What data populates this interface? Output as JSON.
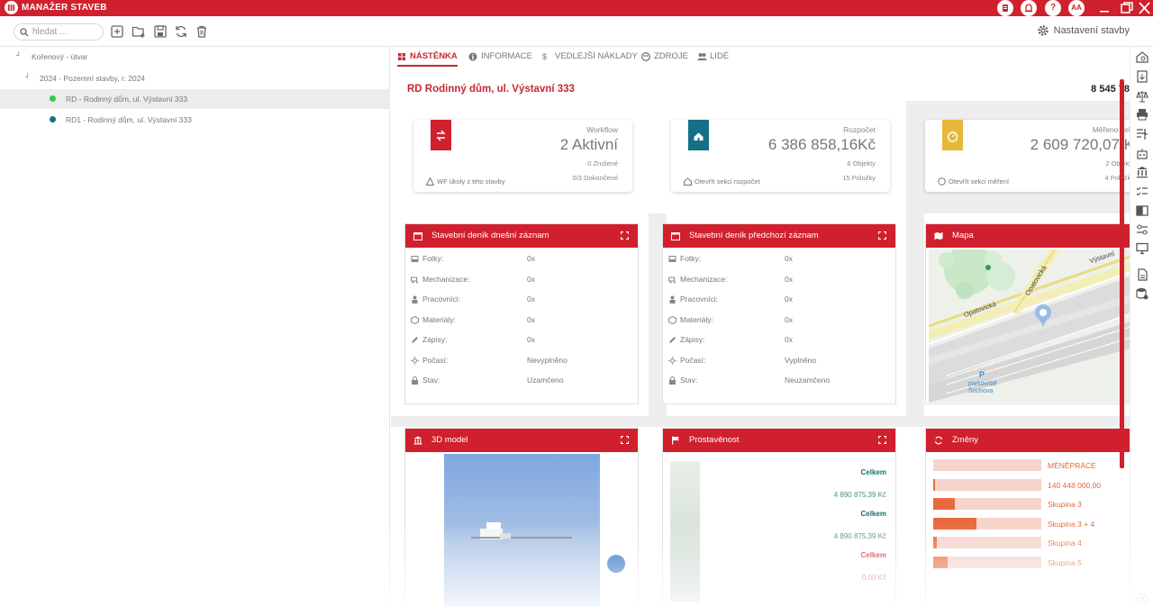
{
  "app": {
    "title": "MANAŽER STAVEB"
  },
  "titlebar": {
    "user_initials": "AA",
    "help_label": "?"
  },
  "toolbar": {
    "search_placeholder": "hledat ...",
    "settings_label": "Nastavení stavby"
  },
  "tree": {
    "items": [
      {
        "label": "Kořenový - útvar"
      },
      {
        "label": "2024 - Pozemní stavby, r. 2024"
      },
      {
        "label": "RD - Rodinný dům, ul. Výstavní 333",
        "status_color": "#2ecc4a"
      },
      {
        "label": "RD1 - Rodinný dům, ul. Výstavní 333",
        "status_color": "#156f86"
      }
    ]
  },
  "tabs": [
    {
      "label": "NÁSTĚNKA",
      "icon": "dashboard-icon"
    },
    {
      "label": "INFORMACE",
      "icon": "info-icon"
    },
    {
      "label": "VEDLEJŠÍ NÁKLADY",
      "icon": "dollar-icon"
    },
    {
      "label": "ZDROJE",
      "icon": "palette-icon"
    },
    {
      "label": "LIDÉ",
      "icon": "people-icon"
    }
  ],
  "project": {
    "title": "RD Rodinný dům, ul. Výstavní 333",
    "total": "8 545 78"
  },
  "kpis": [
    {
      "label": "Workflow",
      "value": "2 Aktivní",
      "sub1": "0 Zrušené",
      "sub2": "0/3 Dokončené",
      "link": "WF úkoly z této stavby",
      "color": "#d0202e",
      "icon": "workflow-icon"
    },
    {
      "label": "Rozpočet",
      "value": "6 386 858,16Kč",
      "sub1": "6 Objekty",
      "sub2": "15 Položky",
      "link": "Otevřít sekci rozpočet",
      "color": "#156f86",
      "icon": "home-icon"
    },
    {
      "label": "Měřeno celk",
      "value": "2 609 720,07 K",
      "sub1": "2 Objekty",
      "sub2": "4 Položky",
      "link": "Otevřít sekci měření",
      "color": "#e6b83a",
      "icon": "gauge-icon"
    }
  ],
  "diary_today": {
    "title": "Stavební deník dnešní záznam",
    "rows": [
      {
        "label": "Fotky:",
        "value": "0x",
        "icon": "photo-icon"
      },
      {
        "label": "Mechanizace:",
        "value": "0x",
        "icon": "truck-icon"
      },
      {
        "label": "Pracovníci:",
        "value": "0x",
        "icon": "worker-icon"
      },
      {
        "label": "Materiály:",
        "value": "0x",
        "icon": "box-icon"
      },
      {
        "label": "Zápisy:",
        "value": "0x",
        "icon": "pencil-icon"
      },
      {
        "label": "Počasí:",
        "value": "Nevyplněno",
        "icon": "sun-icon"
      },
      {
        "label": "Stav:",
        "value": "Uzamčeno",
        "icon": "lock-icon"
      }
    ]
  },
  "diary_prev": {
    "title": "Stavební deník předchozí záznam",
    "rows": [
      {
        "label": "Fotky:",
        "value": "0x",
        "icon": "photo-icon"
      },
      {
        "label": "Mechanizace:",
        "value": "0x",
        "icon": "truck-icon"
      },
      {
        "label": "Pracovníci:",
        "value": "0x",
        "icon": "worker-icon"
      },
      {
        "label": "Materiály:",
        "value": "0x",
        "icon": "box-icon"
      },
      {
        "label": "Zápisy:",
        "value": "0x",
        "icon": "pencil-icon"
      },
      {
        "label": "Počasí:",
        "value": "Vyplněno",
        "icon": "sun-icon"
      },
      {
        "label": "Stav:",
        "value": "Neuzamčeno",
        "icon": "lock-icon"
      }
    ]
  },
  "map": {
    "title": "Mapa",
    "street1": "Opatovická",
    "street2": "Opatovická",
    "street3": "Výstavní",
    "poi": "parkoviště Šnchova",
    "poi_letter": "P"
  },
  "model3d": {
    "title": "3D model"
  },
  "prostavenost": {
    "title": "Prostavěnost",
    "labels": [
      {
        "text": "Celkem",
        "kind": "label",
        "color": "#1a7068"
      },
      {
        "text": "4 890 875,39 Kč",
        "kind": "value",
        "color": "#1a7068"
      },
      {
        "text": "Celkem",
        "kind": "label",
        "color": "#1a7068"
      },
      {
        "text": "4 890 875,39 Kč",
        "kind": "value",
        "color": "#1a7068"
      },
      {
        "text": "Celkem",
        "kind": "label",
        "color": "#d0202e"
      },
      {
        "text": "0,00 Kč",
        "kind": "value",
        "color": "#d0202e"
      }
    ]
  },
  "zmeny": {
    "title": "Změny",
    "rows": [
      {
        "label": "MÉNĚPRÁCE",
        "fill_fraction": 0.0
      },
      {
        "label": "140 448 000,00",
        "fill_fraction": 0.01
      },
      {
        "label": "Skupina 3",
        "fill_fraction": 0.2
      },
      {
        "label": "Skupina 3 + 4",
        "fill_fraction": 0.4
      },
      {
        "label": "Skupina 4",
        "fill_fraction": 0.03
      },
      {
        "label": "Skupina 5",
        "fill_fraction": 0.13
      }
    ]
  }
}
